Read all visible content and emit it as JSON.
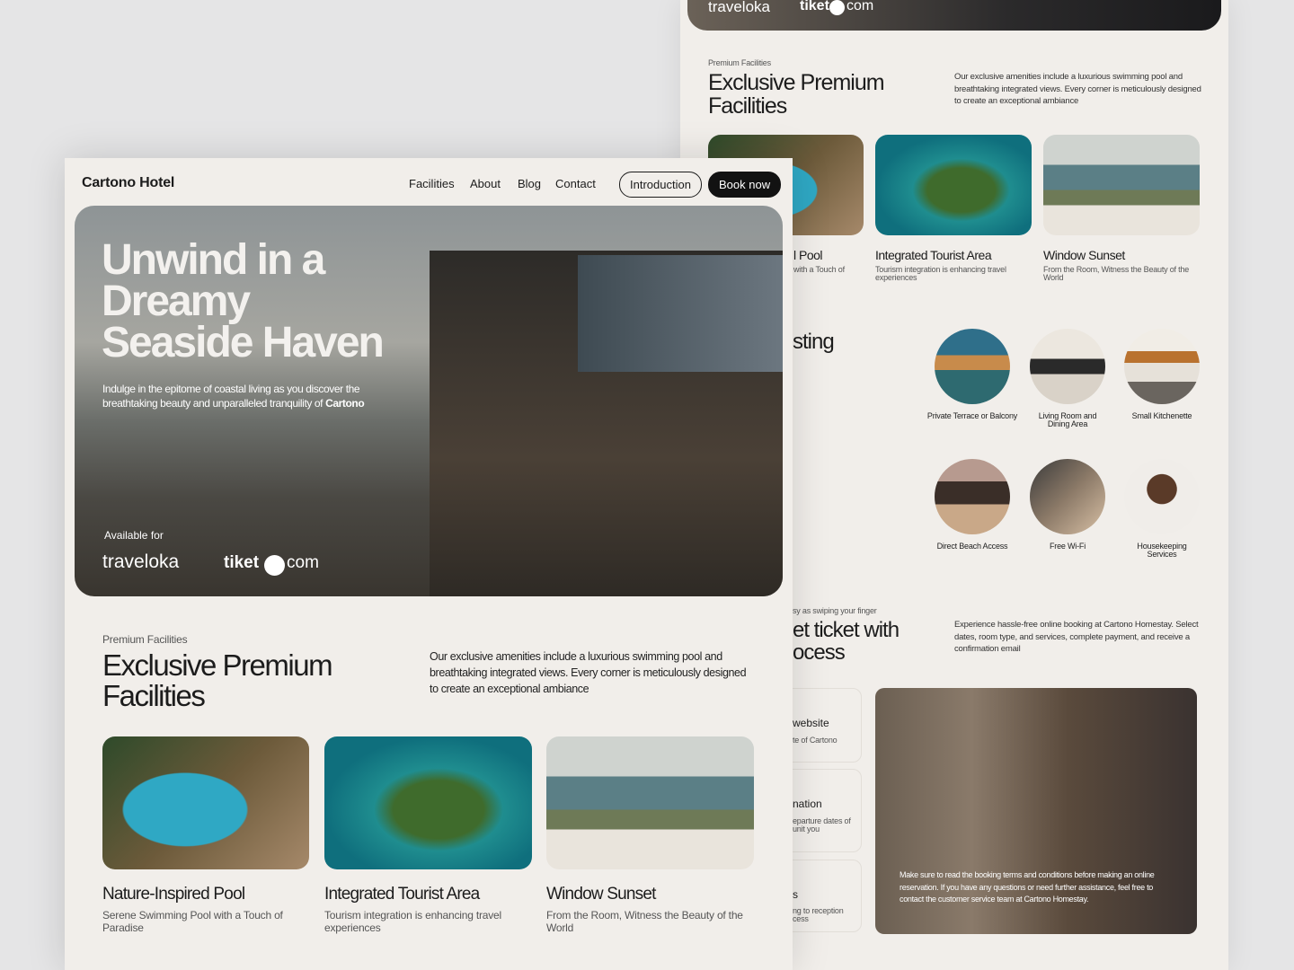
{
  "back": {
    "partners": [
      "traveloka",
      "tiket",
      "com"
    ],
    "facilities": {
      "eyebrow": "Premium Facilities",
      "title_1": "Exclusive Premium",
      "title_2": "Facilities",
      "description": "Our exclusive amenities include a luxurious swimming pool and breathtaking integrated views. Every corner is meticulously designed to create an exceptional ambiance",
      "cards": [
        {
          "title": "l Pool",
          "subtitle": "with a Touch of"
        },
        {
          "title": "Integrated Tourist Area",
          "subtitle": "Tourism integration is enhancing travel experiences"
        },
        {
          "title": "Window Sunset",
          "subtitle": "From the Room, Witness the Beauty of the World"
        }
      ]
    },
    "amenities": {
      "title": "sting",
      "items": [
        "Private Terrace or Balcony",
        "Living Room and Dining Area",
        "Small Kitchenette",
        "Direct Beach Access",
        "Free Wi-Fi",
        "Housekeeping Services"
      ]
    },
    "booking": {
      "eyebrow": "sy as swiping your finger",
      "title_1": "et ticket with",
      "title_2": "ocess",
      "description": "Experience hassle-free online booking at Cartono Homestay. Select dates, room type, and services, complete payment, and receive a confirmation email",
      "steps": [
        {
          "title": "website",
          "text": "te of Cartono"
        },
        {
          "title": "nation",
          "text": "eparture dates of unit you"
        },
        {
          "title": "s",
          "text": "ng to reception cess"
        }
      ],
      "note": "Make sure to read the booking terms and conditions before making an online reservation. If you have any questions or need further assistance, feel free to contact the customer service team at Cartono Homestay."
    }
  },
  "front": {
    "brand": "Cartono Hotel",
    "nav": [
      "Facilities",
      "About",
      "Blog",
      "Contact"
    ],
    "intro_button": "Introduction",
    "book_button": "Book now",
    "hero": {
      "title_1": "Unwind in a",
      "title_2": "Dreamy",
      "title_3": "Seaside Haven",
      "subtitle": "Indulge in the epitome of coastal living as you discover the breathtaking beauty and unparalleled tranquility of ",
      "subtitle_bold": "Cartono",
      "available": "Available for",
      "partners": [
        "traveloka",
        "tiket",
        "com"
      ]
    },
    "facilities": {
      "eyebrow": "Premium Facilities",
      "title_1": "Exclusive Premium",
      "title_2": "Facilities",
      "description": "Our exclusive amenities include a luxurious swimming pool and breathtaking integrated views. Every corner is meticulously designed to create an exceptional ambiance",
      "cards": [
        {
          "title": "Nature-Inspired Pool",
          "subtitle": "Serene Swimming Pool with a Touch of Paradise"
        },
        {
          "title": "Integrated Tourist Area",
          "subtitle": "Tourism integration is enhancing travel experiences"
        },
        {
          "title": "Window Sunset",
          "subtitle": "From the Room, Witness the Beauty of the World"
        }
      ]
    }
  }
}
